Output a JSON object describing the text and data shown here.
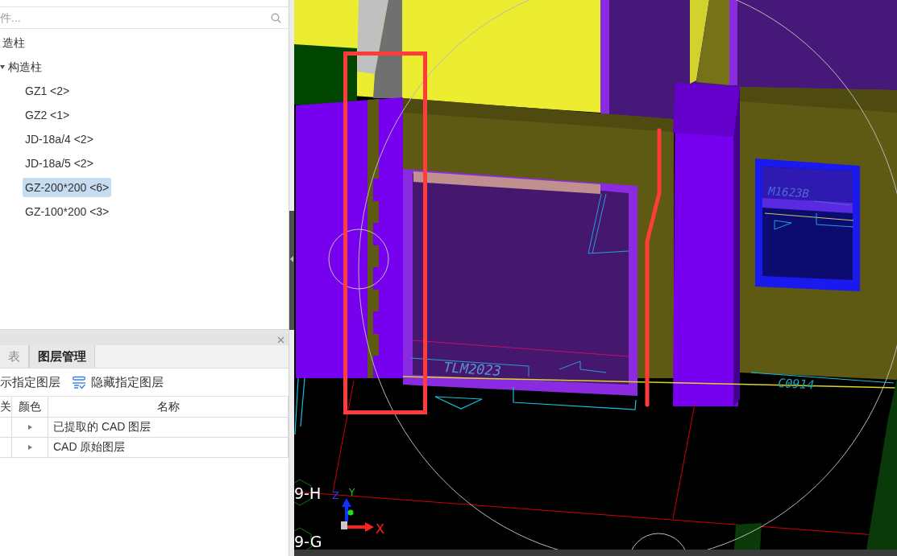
{
  "search": {
    "placeholder": "件..."
  },
  "tree": [
    {
      "label": "造柱",
      "children": [
        {
          "label": "构造柱",
          "expanded": true,
          "children": [
            {
              "label": "GZ1 <2>",
              "selected": false
            },
            {
              "label": "GZ2 <1>",
              "selected": false
            },
            {
              "label": "JD-18a/4 <2>",
              "selected": false
            },
            {
              "label": "JD-18a/5 <2>",
              "selected": false
            },
            {
              "label": "GZ-200*200 <6>",
              "selected": true
            },
            {
              "label": "GZ-100*200 <3>",
              "selected": false
            }
          ]
        }
      ]
    }
  ],
  "layer_panel": {
    "tabs": [
      {
        "label": "表",
        "selected": false
      },
      {
        "label": "图层管理",
        "selected": true
      }
    ],
    "actions": [
      {
        "label": "示指定图层",
        "kind": "text"
      },
      {
        "label": "隐藏指定图层",
        "kind": "icon"
      }
    ],
    "table": {
      "columns": [
        "关",
        "颜色",
        "名称"
      ],
      "rows": [
        {
          "name": "已提取的 CAD 图层",
          "expanded": false
        },
        {
          "name": "CAD 原始图层",
          "expanded": false
        }
      ]
    }
  },
  "viewport": {
    "cad_labels": [
      "M1623B",
      "TLM2023",
      "C0914"
    ],
    "grid_labels": [
      "9-H",
      "9-G"
    ],
    "axes": {
      "x": "X",
      "y": "Y",
      "z": "Z"
    }
  }
}
